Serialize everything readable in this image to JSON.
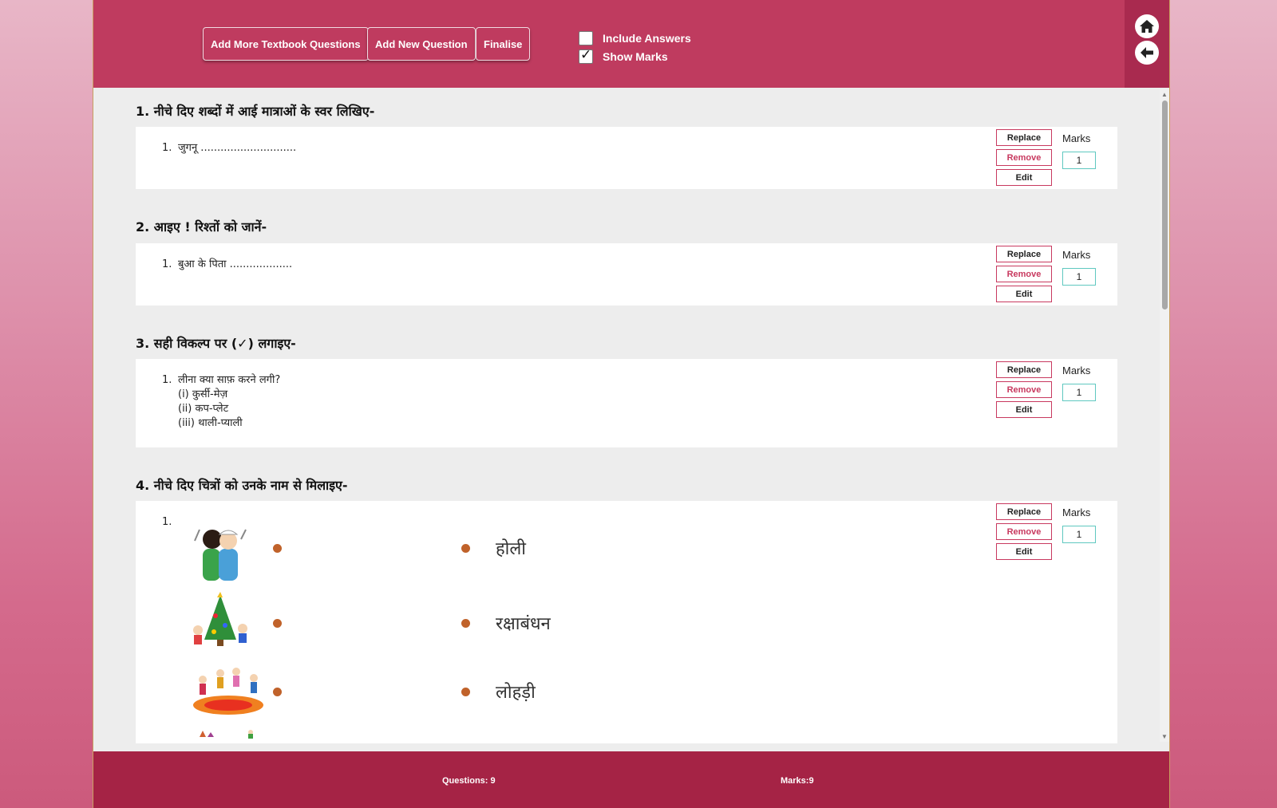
{
  "toolbar": {
    "add_more_label": "Add More Textbook Questions",
    "add_new_label": "Add New Question",
    "finalise_label": "Finalise",
    "include_answers_label": "Include Answers",
    "include_answers_checked": false,
    "show_marks_label": "Show Marks",
    "show_marks_checked": true
  },
  "nav": {
    "home_icon": "home-icon",
    "back_icon": "arrow-left-icon"
  },
  "actions": {
    "replace": "Replace",
    "remove": "Remove",
    "edit": "Edit",
    "marks": "Marks"
  },
  "questions": [
    {
      "title": "1.  नीचे दिए शब्दों में आई मात्राओं के स्वर लिखिए-",
      "item_num": "1.",
      "item_text": "जुगनू .............................",
      "marks": "1"
    },
    {
      "title": "2.  आइए ! रिश्तों को जानें-",
      "item_num": "1.",
      "item_text": "बुआ के पिता ...................",
      "marks": "1"
    },
    {
      "title": "3.  सही विकल्प पर (✓) लगाइए-",
      "item_num": "1.",
      "item_text": "लीना क्या साफ़ करने लगी?",
      "options": [
        "(i) कुर्सी-मेज़",
        "(ii) कप-प्लेट",
        "(iii) थाली-प्याली"
      ],
      "marks": "1"
    },
    {
      "title": "4.  नीचे दिए चित्रों को उनके नाम से मिलाइए-",
      "item_num": "1.",
      "match_words": [
        "होली",
        "रक्षाबंधन",
        "लोहड़ी"
      ],
      "marks": "1"
    }
  ],
  "footer": {
    "questions": "Questions: 9",
    "marks": "Marks:9"
  },
  "colors": {
    "header": "#bf3b5f",
    "footer": "#a52345",
    "accent": "#c8395f",
    "dot": "#c0622a"
  }
}
